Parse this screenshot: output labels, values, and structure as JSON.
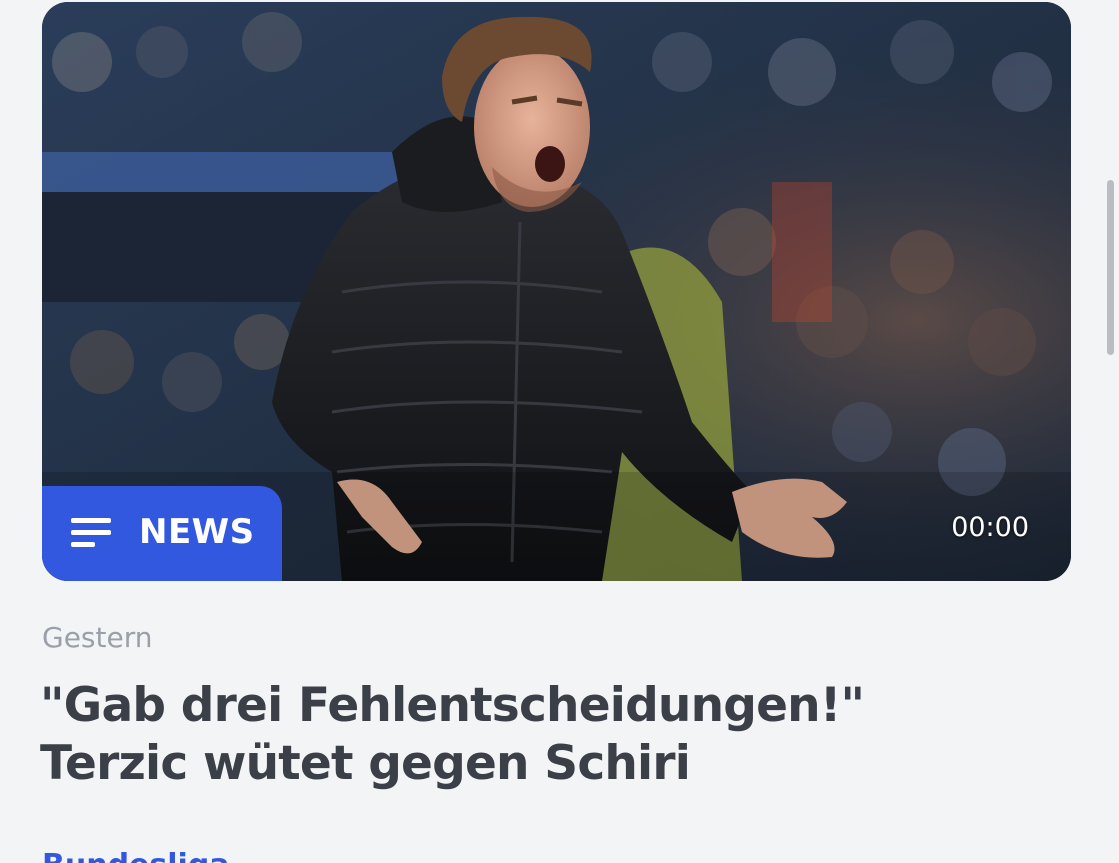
{
  "article": {
    "badge_label": "NEWS",
    "badge_icon": "list-lines-icon",
    "duration": "00:00",
    "date_label": "Gestern",
    "headline_line1": "\"Gab drei Fehlentscheidungen!\"",
    "headline_line2": "Terzic wütet gegen Schiri",
    "category": "Bundesliga"
  },
  "colors": {
    "accent": "#3358e0",
    "headline": "#3b3f47",
    "meta": "#9aa0a8",
    "background": "#f3f4f6"
  }
}
